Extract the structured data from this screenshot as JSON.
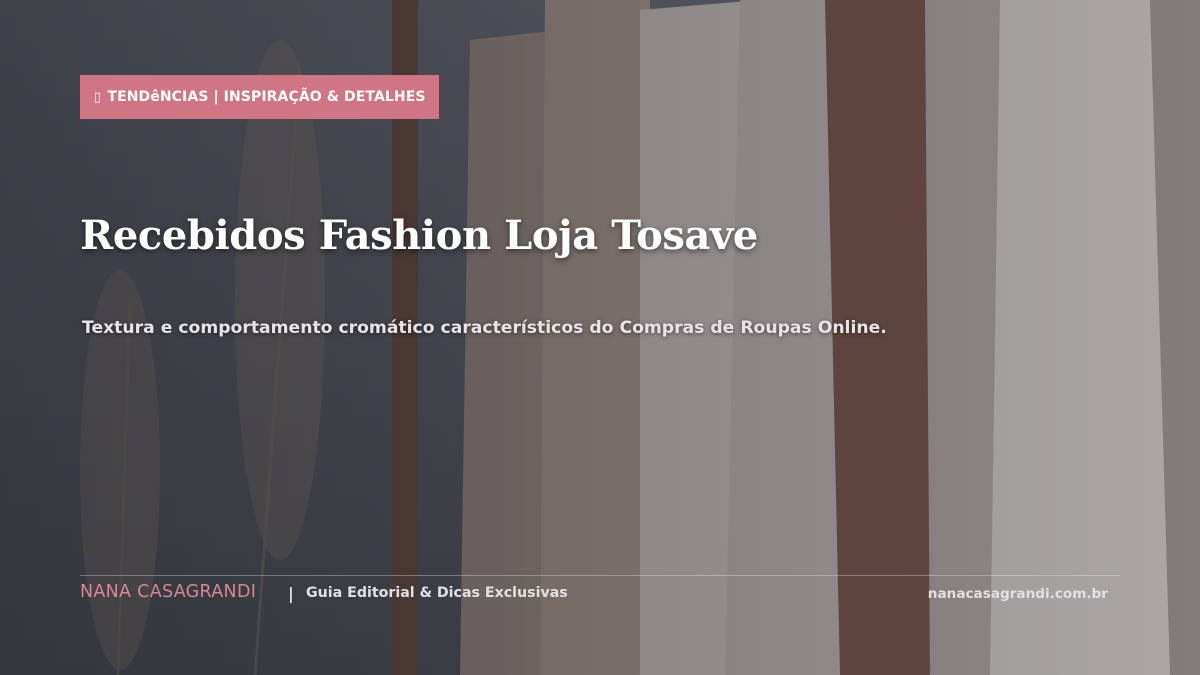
{
  "badge": {
    "icon": "tag-icon",
    "label": "TENDêNCIAS | INSPIRAÇÃO & DETALHES"
  },
  "title": "Recebidos Fashion Loja Tosave",
  "subtitle": "Textura e comportamento cromático característicos do Compras de Roupas Online.",
  "footer": {
    "brand": "NANA CASAGRANDI",
    "separator": "|",
    "tagline": "Guia Editorial & Dicas Exclusivas",
    "url": "nanacasagrandi.com.br"
  },
  "colors": {
    "accent": "#d07585",
    "brand": "#d98796",
    "text": "#ffffff"
  }
}
